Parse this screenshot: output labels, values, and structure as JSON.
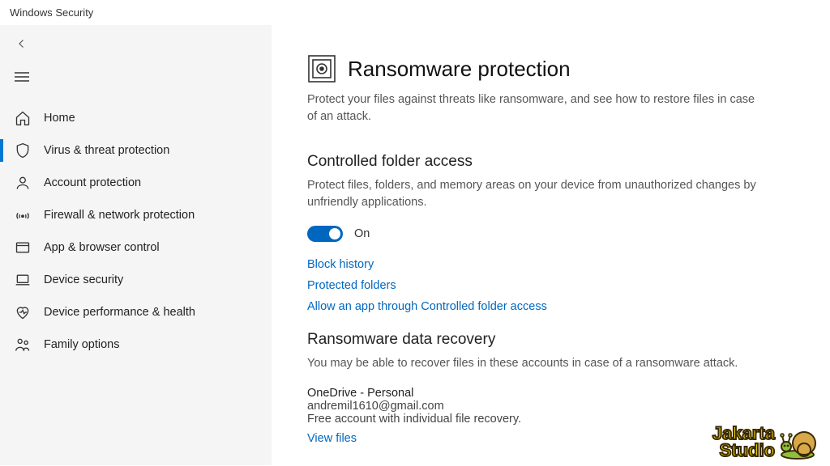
{
  "app": {
    "title": "Windows Security"
  },
  "sidebar": {
    "items": [
      {
        "label": "Home"
      },
      {
        "label": "Virus & threat protection"
      },
      {
        "label": "Account protection"
      },
      {
        "label": "Firewall & network protection"
      },
      {
        "label": "App & browser control"
      },
      {
        "label": "Device security"
      },
      {
        "label": "Device performance & health"
      },
      {
        "label": "Family options"
      }
    ]
  },
  "main": {
    "title": "Ransomware protection",
    "desc": "Protect your files against threats like ransomware, and see how to restore files in case of an attack.",
    "cfa": {
      "title": "Controlled folder access",
      "desc": "Protect files, folders, and memory areas on your device from unauthorized changes by unfriendly applications.",
      "toggle_label": "On",
      "links": {
        "block_history": "Block history",
        "protected_folders": "Protected folders",
        "allow_app": "Allow an app through Controlled folder access"
      }
    },
    "recovery": {
      "title": "Ransomware data recovery",
      "desc": "You may be able to recover files in these accounts in case of a ransomware attack.",
      "account_name": "OneDrive - Personal",
      "account_email": "andremil1610@gmail.com",
      "account_desc": "Free account with individual file recovery.",
      "view_files": "View files"
    }
  },
  "watermark": {
    "line1": "Jakarta",
    "line2": "Studio"
  }
}
